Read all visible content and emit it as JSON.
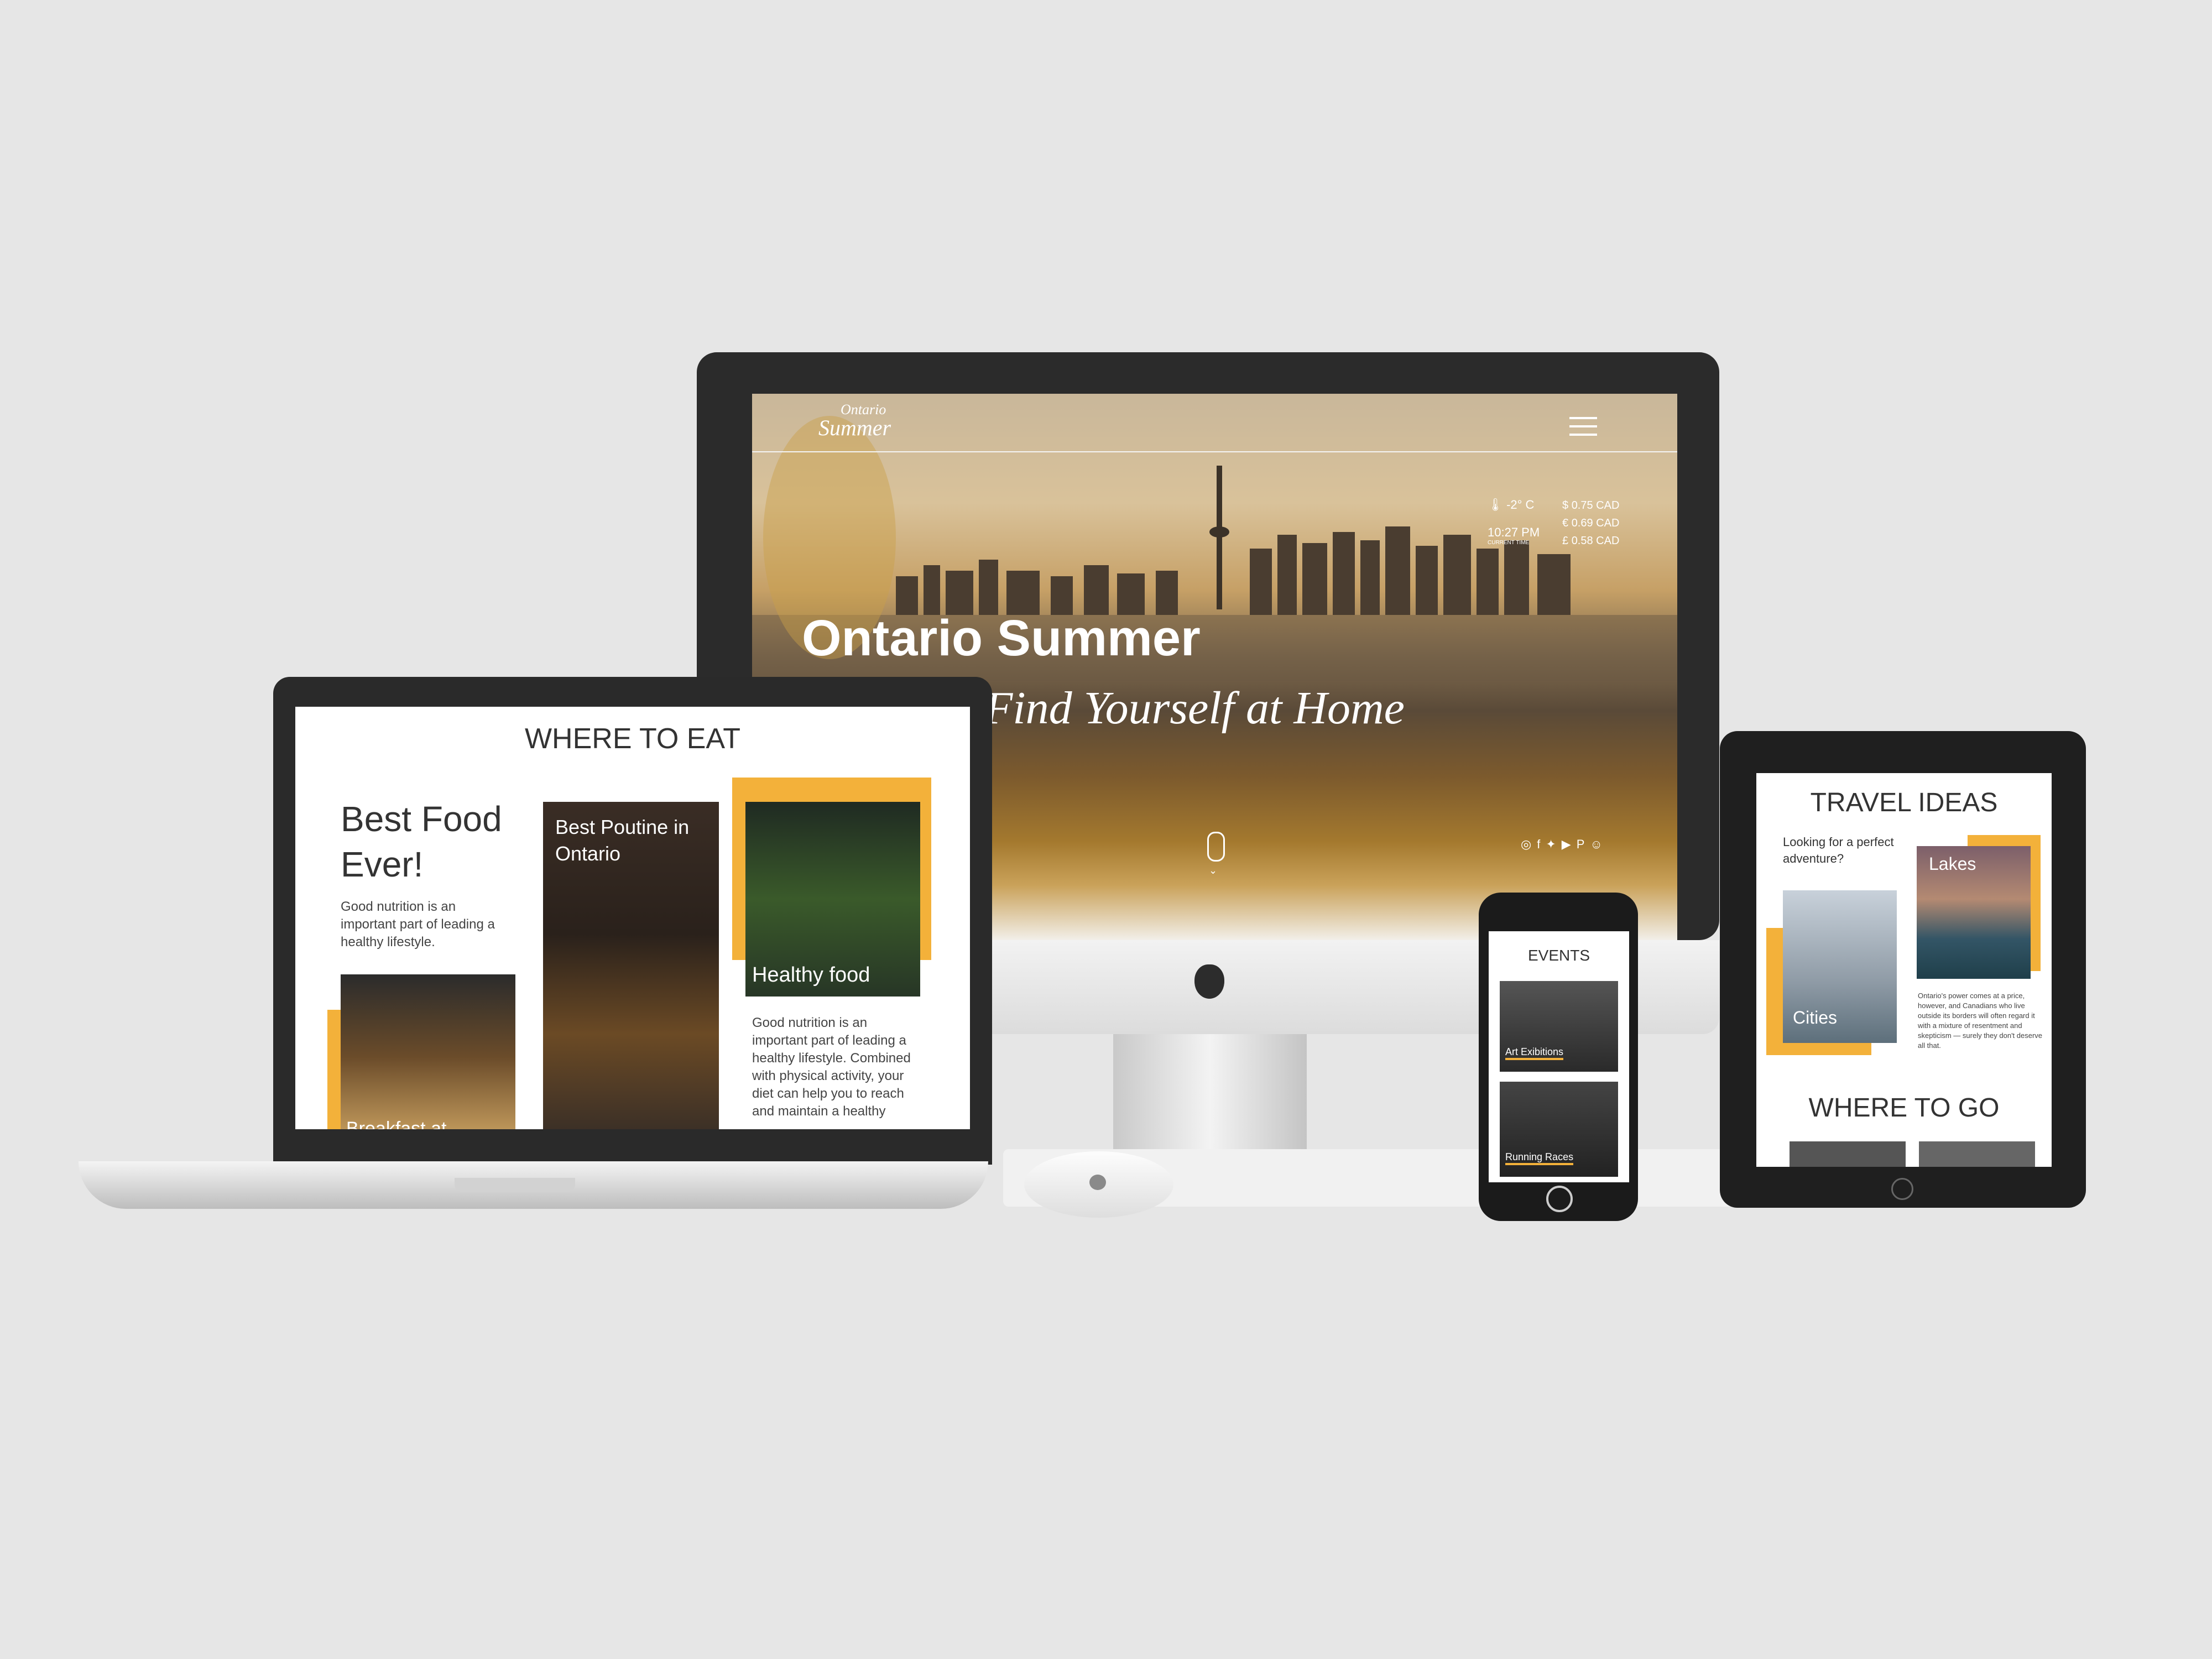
{
  "imac": {
    "logo_line1": "Ontario",
    "logo_line2": "Summer",
    "hero_title": "Ontario Summer",
    "hero_subtitle": "Find Yourself at Home",
    "weather": {
      "temperature": "-2° C",
      "time": "10:27 PM",
      "time_caption": "CURRENT TIME"
    },
    "currency": [
      {
        "symbol": "$",
        "value": "0.75 CAD"
      },
      {
        "symbol": "€",
        "value": "0.69 CAD"
      },
      {
        "symbol": "£",
        "value": "0.58 CAD"
      }
    ],
    "social_icons": [
      "instagram-icon",
      "facebook-icon",
      "twitter-icon",
      "youtube-icon",
      "pinterest-icon",
      "snapchat-icon"
    ]
  },
  "laptop": {
    "section_title": "WHERE TO EAT",
    "headline": "Best Food Ever!",
    "intro": "Good nutrition is an important part of leading a healthy lifestyle.",
    "card_breakfast": "Breakfast at",
    "card_poutine": "Best Poutine in Ontario",
    "card_healthy": "Healthy food",
    "body_text": "Good nutrition is an important part of leading a healthy lifestyle. Combined with physical activity, your diet can help you to reach and maintain a healthy"
  },
  "phone": {
    "section_title": "EVENTS",
    "card1": "Art Exibitions",
    "card2": "Running Races"
  },
  "tablet": {
    "section_title": "TRAVEL IDEAS",
    "question": "Looking for a perfect adventure?",
    "card_cities": "Cities",
    "card_lakes": "Lakes",
    "paragraph": "Ontario's power comes at a price, however, and Canadians who live outside its borders will often regard it with a mixture of resentment and skepticism — surely they don't deserve all that.",
    "section_title_2": "WHERE TO GO"
  },
  "colors": {
    "accent": "#f3b13a",
    "background": "#e6e6e6"
  }
}
